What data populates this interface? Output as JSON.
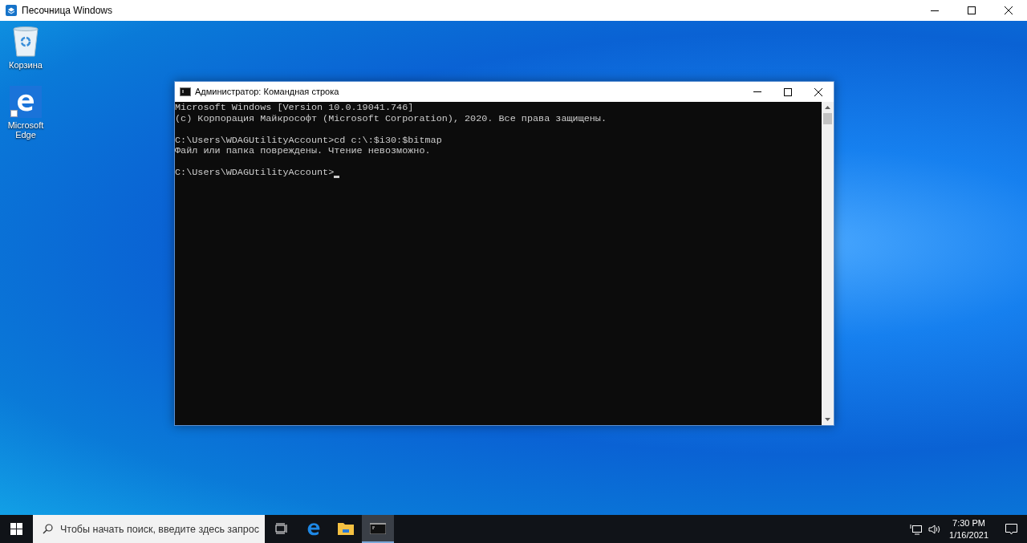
{
  "host_window": {
    "title": "Песочница Windows"
  },
  "desktop_icons": [
    {
      "kind": "recycle",
      "label": "Корзина"
    },
    {
      "kind": "edge",
      "label": "Microsoft Edge"
    }
  ],
  "console_window": {
    "title": "Администратор: Командная строка",
    "cursor": true,
    "blocks": [
      [
        "Microsoft Windows [Version 10.0.19041.746]",
        "(c) Корпорация Майкрософт (Microsoft Corporation), 2020. Все права защищены."
      ],
      [
        "C:\\Users\\WDAGUtilityAccount>cd c:\\:$i30:$bitmap",
        "Файл или папка повреждены. Чтение невозможно."
      ],
      [
        "C:\\Users\\WDAGUtilityAccount>"
      ]
    ]
  },
  "taskbar": {
    "search": {
      "placeholder": "Чтобы начать поиск, введите здесь запрос"
    },
    "apps": [
      {
        "kind": "taskview",
        "selected": false
      },
      {
        "kind": "edge",
        "selected": false
      },
      {
        "kind": "explorer",
        "selected": false
      },
      {
        "kind": "console",
        "selected": true
      }
    ],
    "clock": {
      "time": "7:30 PM",
      "date": "1/16/2021"
    }
  }
}
